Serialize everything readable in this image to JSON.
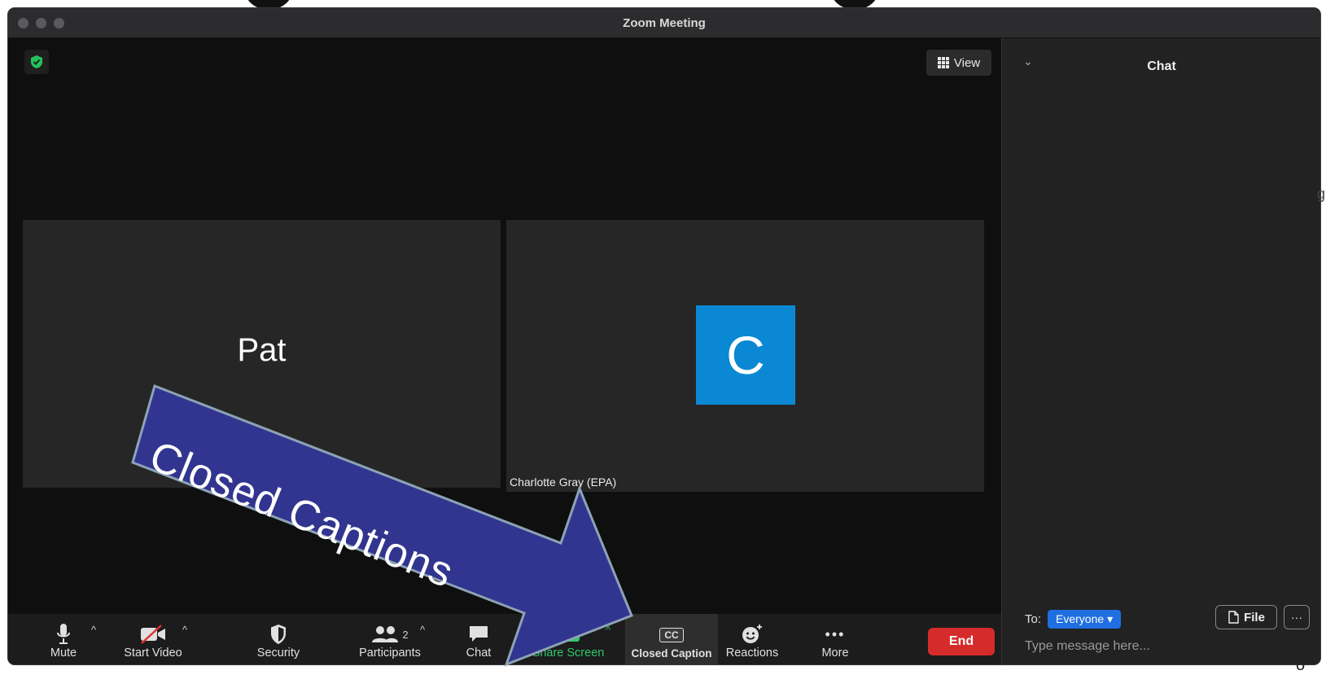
{
  "window": {
    "title": "Zoom Meeting"
  },
  "stage": {
    "view_label": "View",
    "tiles": [
      {
        "name": "Pat"
      },
      {
        "name": "Charlotte Gray (EPA)",
        "avatar_letter": "C",
        "avatar_color": "#0a88d4"
      }
    ]
  },
  "toolbar": {
    "mute": "Mute",
    "start_video": "Start Video",
    "security": "Security",
    "participants": "Participants",
    "participants_count": "2",
    "chat": "Chat",
    "share_screen": "Share Screen",
    "closed_caption": "Closed Caption",
    "cc_glyph": "CC",
    "reactions": "Reactions",
    "more": "More",
    "end": "End"
  },
  "chat": {
    "title": "Chat",
    "to_label": "To:",
    "recipient": "Everyone",
    "file_label": "File",
    "input_placeholder": "Type message here..."
  },
  "annotation": {
    "text": "Closed Captions",
    "color": "#32358f"
  },
  "colors": {
    "end": "#d52b2b",
    "share": "#2cc96a",
    "recipient": "#1f6fe0"
  }
}
